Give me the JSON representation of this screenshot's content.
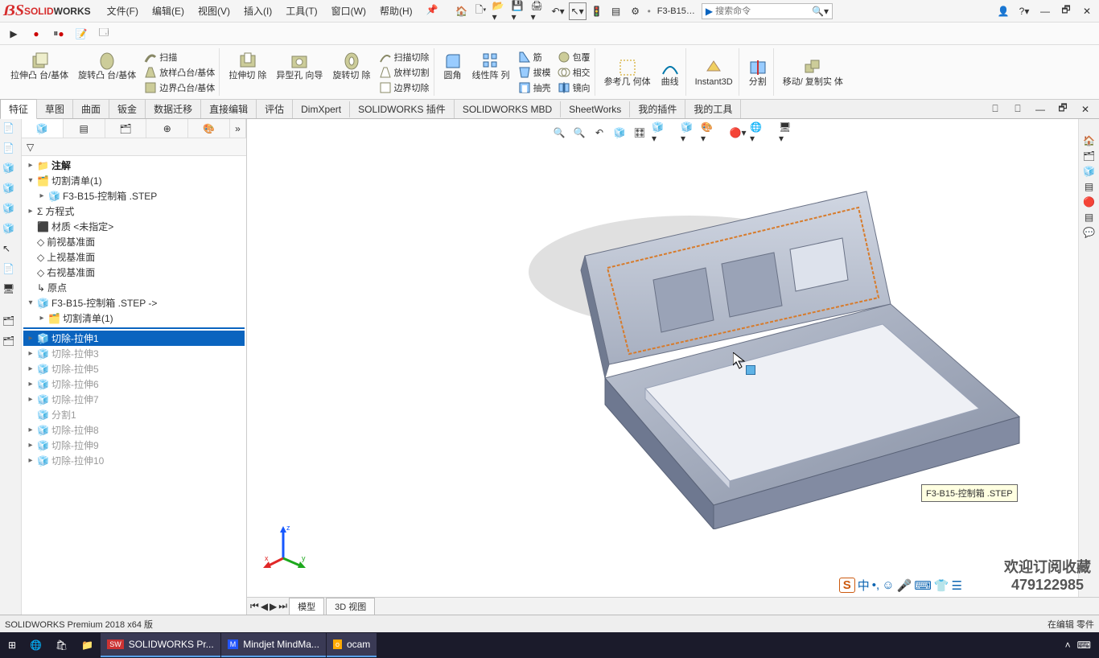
{
  "app": {
    "brand_solid": "SOLID",
    "brand_works": "WORKS"
  },
  "menu": [
    "文件(F)",
    "编辑(E)",
    "视图(V)",
    "插入(I)",
    "工具(T)",
    "窗口(W)",
    "帮助(H)"
  ],
  "doc_name": "F3-B15…",
  "search_placeholder": "搜索命令",
  "ribbon": {
    "g1a": "拉伸凸\n台/基体",
    "g1b": "旋转凸\n台/基体",
    "g1c1": "扫描",
    "g1c2": "放样凸台/基体",
    "g1c3": "边界凸台/基体",
    "g2a": "拉伸切\n除",
    "g2b": "异型孔\n向导",
    "g2c": "旋转切\n除",
    "g2d1": "扫描切除",
    "g2d2": "放样切割",
    "g2d3": "边界切除",
    "g3a": "圆角",
    "g3b": "线性阵\n列",
    "g3c1": "筋",
    "g3c2": "拔模",
    "g3c3": "抽壳",
    "g3d1": "包覆",
    "g3d2": "相交",
    "g3d3": "镜向",
    "g4a": "参考几\n何体",
    "g4b": "曲线",
    "g5": "Instant3D",
    "g6": "分割",
    "g7": "移动/\n复制实\n体"
  },
  "tabs": [
    "特征",
    "草图",
    "曲面",
    "钣金",
    "数据迁移",
    "直接编辑",
    "评估",
    "DimXpert",
    "SOLIDWORKS 插件",
    "SOLIDWORKS MBD",
    "SheetWorks",
    "我的插件",
    "我的工具"
  ],
  "active_tab": 0,
  "tree": {
    "n_annot": "注解",
    "n_cutlist": "切割清单(1)",
    "n_step1": "F3-B15-控制箱 .STEP",
    "n_equ": "方程式",
    "n_mat": "材质 <未指定>",
    "n_front": "前视基准面",
    "n_top": "上视基准面",
    "n_right": "右视基准面",
    "n_origin": "原点",
    "n_body": "F3-B15-控制箱 .STEP ->",
    "n_cutlist2": "切割清单(1)",
    "f1": "切除-拉伸1",
    "f2": "切除-拉伸3",
    "f3": "切除-拉伸5",
    "f4": "切除-拉伸6",
    "f5": "切除-拉伸7",
    "f6": "分割1",
    "f7": "切除-拉伸8",
    "f8": "切除-拉伸9",
    "f9": "切除-拉伸10"
  },
  "bottom_tabs": [
    "模型",
    "3D 视图"
  ],
  "status_left": "SOLIDWORKS Premium 2018 x64 版",
  "status_right": "在编辑 零件",
  "tooltip_text": "F3-B15-控制箱 .STEP",
  "watermark": {
    "l1": "欢迎订阅收藏",
    "l2": "479122985"
  },
  "taskbar": {
    "i1": "SOLIDWORKS Pr...",
    "i2": "Mindjet MindMa...",
    "i3": "ocam"
  },
  "triad": {
    "x": "x",
    "y": "y",
    "z": "z"
  }
}
